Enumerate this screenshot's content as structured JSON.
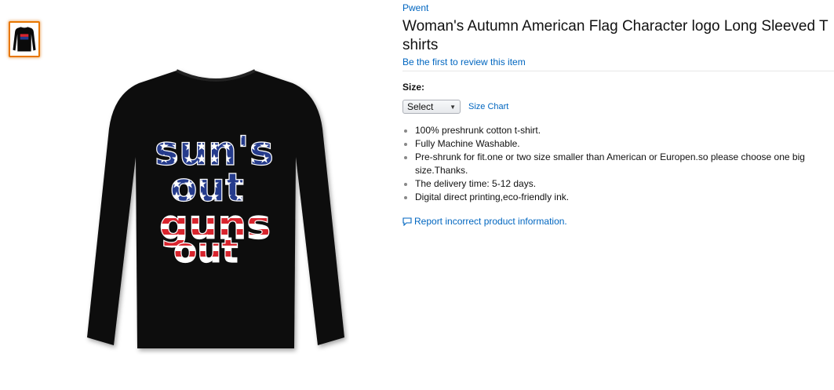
{
  "product": {
    "brand": "Pwent",
    "title": "Woman's Autumn American Flag Character logo Long Sleeved T shirts",
    "review_link": "Be the first to review this item",
    "shirt_text": [
      "sun's",
      "out",
      "guns",
      "out"
    ]
  },
  "size": {
    "label": "Size:",
    "selected": "Select",
    "chart_link": "Size Chart"
  },
  "features": [
    "100% preshrunk cotton t-shirt.",
    "Fully Machine Washable.",
    "Pre-shrunk for fit.one or two size smaller than American or Europen.so please choose one big size.Thanks.",
    "The delivery time: 5-12 days.",
    "Digital direct printing,eco-friendly ink."
  ],
  "report": {
    "label": "Report incorrect product information.",
    "icon": "comment-icon"
  },
  "colors": {
    "link": "#0066c0",
    "thumb_border": "#e77600",
    "shirt": "#0a0a0a",
    "flag_red": "#d8242d",
    "flag_blue": "#253b8c"
  }
}
